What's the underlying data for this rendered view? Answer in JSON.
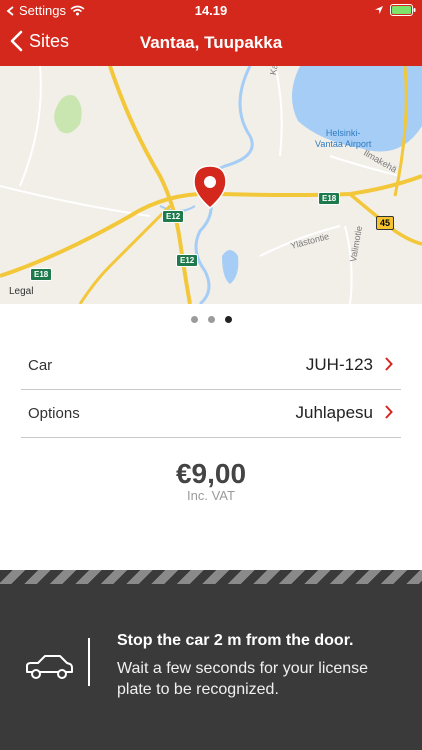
{
  "status_bar": {
    "back_app": "Settings",
    "time": "14.19"
  },
  "nav": {
    "back_label": "Sites",
    "title": "Vantaa, Tuupakka"
  },
  "map": {
    "labels": {
      "airport": "Helsinki-\nVantaa Airport",
      "road_katrin": "Katriinа",
      "road_ilmakeha": "Ilmakehä",
      "road_ylasto": "Ylästontie",
      "road_valimo": "Valimotie"
    },
    "shields": {
      "e12_top": "E12",
      "e12_bottom": "E12",
      "e18_right": "E18",
      "e18_left": "E18",
      "route_45": "45"
    },
    "legal": "Legal"
  },
  "pager": {
    "count": 3,
    "active_index": 2
  },
  "rows": {
    "car": {
      "label": "Car",
      "value": "JUH-123"
    },
    "options": {
      "label": "Options",
      "value": "Juhlapesu"
    }
  },
  "price": {
    "amount": "€9,00",
    "vat_note": "Inc. VAT"
  },
  "instructions": {
    "title": "Stop the car 2 m from the door.",
    "body": "Wait a few seconds for your license plate to be recognized."
  },
  "colors": {
    "brand_red": "#d3281b",
    "panel_dark": "#3a3a3a",
    "chevron_red": "#d3281b"
  },
  "icons": [
    "back-chevron-icon",
    "wifi-icon",
    "location-arrow-icon",
    "battery-icon",
    "map-pin-icon",
    "chevron-right-icon",
    "car-icon"
  ]
}
